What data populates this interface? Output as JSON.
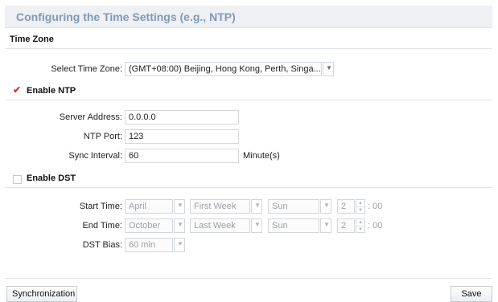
{
  "page": {
    "title": "Configuring the Time Settings (e.g., NTP)"
  },
  "time_zone": {
    "section_label": "Time Zone",
    "select_label": "Select Time Zone:",
    "select_value": "(GMT+08:00) Beijing, Hong Kong, Perth, Singa..."
  },
  "ntp": {
    "enabled": true,
    "checkbox_label": "Enable NTP",
    "server_label": "Server Address:",
    "server_value": "0.0.0.0",
    "port_label": "NTP Port:",
    "port_value": "123",
    "interval_label": "Sync Interval:",
    "interval_value": "60",
    "interval_unit": "Minute(s)"
  },
  "dst": {
    "enabled": false,
    "checkbox_label": "Enable DST",
    "start_label": "Start Time:",
    "start_month": "April",
    "start_week": "First Week",
    "start_day": "Sun",
    "start_hour": "2",
    "start_suffix": ": 00",
    "end_label": "End Time:",
    "end_month": "October",
    "end_week": "Last Week",
    "end_day": "Sun",
    "end_hour": "2",
    "end_suffix": ": 00",
    "bias_label": "DST Bias:",
    "bias_value": "60 min"
  },
  "buttons": {
    "sync_label": "Synchronization",
    "save_label": "Save"
  },
  "colors": {
    "title": "#7e9ab8",
    "check": "#d23a2a",
    "disabled_text": "#9aa0a6"
  }
}
